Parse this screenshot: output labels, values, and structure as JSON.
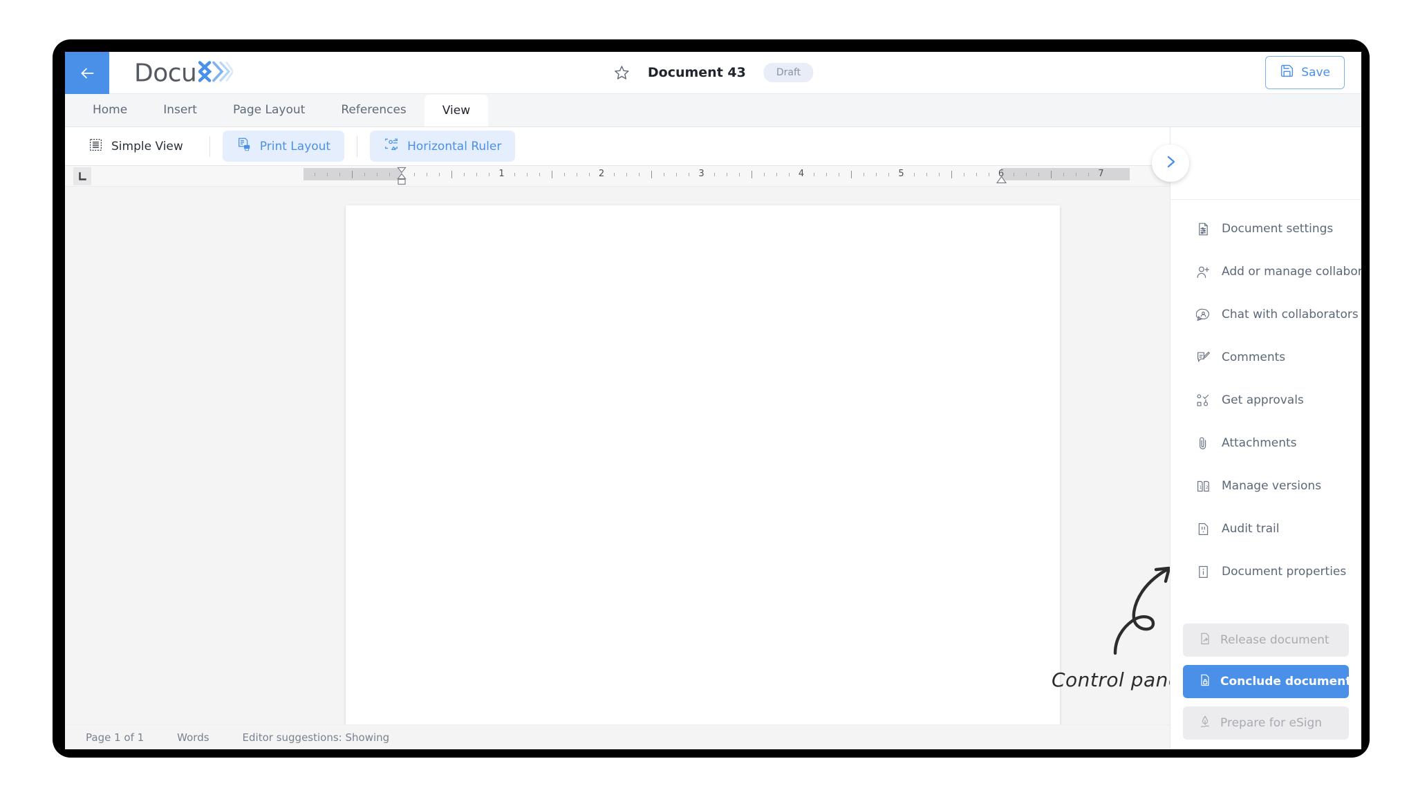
{
  "header": {
    "back_icon": "arrow-left-icon",
    "brand_name": "Docu",
    "brand_mark": "x-chevrons-icon",
    "star_icon": "star-outline-icon",
    "document_title": "Document 43",
    "status_badge": "Draft",
    "save_label": "Save",
    "save_icon": "floppy-disk-icon"
  },
  "tabs": [
    {
      "label": "Home",
      "active": false
    },
    {
      "label": "Insert",
      "active": false
    },
    {
      "label": "Page Layout",
      "active": false
    },
    {
      "label": "References",
      "active": false
    },
    {
      "label": "View",
      "active": true
    }
  ],
  "ribbon": {
    "buttons": [
      {
        "label": "Simple View",
        "icon": "simple-view-icon",
        "toggled": false
      },
      {
        "label": "Print Layout",
        "icon": "print-layout-icon",
        "toggled": true
      },
      {
        "label": "Horizontal Ruler",
        "icon": "horizontal-ruler-icon",
        "toggled": true
      }
    ]
  },
  "ruler": {
    "tab_stop_icon": "tab-stop-left-icon",
    "numbers": [
      "1",
      "1",
      "2",
      "3",
      "4",
      "5",
      "6",
      "7"
    ],
    "left_indent_icon": "left-indent-handle",
    "right_indent_icon": "right-indent-handle"
  },
  "annotation": {
    "label": "Control panel",
    "arrow_icon": "curly-arrow-icon"
  },
  "control_panel": {
    "toggle_icon": "chevron-right-icon",
    "items": [
      {
        "label": "Document settings",
        "icon": "document-settings-icon"
      },
      {
        "label": "Add or manage collaborators",
        "icon": "user-add-icon"
      },
      {
        "label": "Chat with collaborators",
        "icon": "chat-bubble-icon"
      },
      {
        "label": "Comments",
        "icon": "comment-edit-icon"
      },
      {
        "label": "Get approvals",
        "icon": "approvals-icon"
      },
      {
        "label": "Attachments",
        "icon": "paperclip-icon"
      },
      {
        "label": "Manage versions",
        "icon": "versions-icon"
      },
      {
        "label": "Audit trail",
        "icon": "audit-trail-icon"
      },
      {
        "label": "Document properties",
        "icon": "info-document-icon"
      }
    ],
    "actions": [
      {
        "label": "Release document",
        "icon": "release-document-icon",
        "state": "disabled"
      },
      {
        "label": "Conclude document",
        "icon": "conclude-document-icon",
        "state": "primary"
      },
      {
        "label": "Prepare for eSign",
        "icon": "esign-pen-icon",
        "state": "disabled"
      }
    ]
  },
  "status_bar": {
    "page_info": "Page 1 of 1",
    "words": "Words",
    "editor_suggestions": "Editor suggestions: Showing"
  },
  "colors": {
    "accent_blue": "#4a90e8",
    "toggle_bg": "#e4eefc",
    "badge_bg": "#e8edf8",
    "panel_text": "#5c6878",
    "canvas_bg": "#f4f4f5"
  }
}
